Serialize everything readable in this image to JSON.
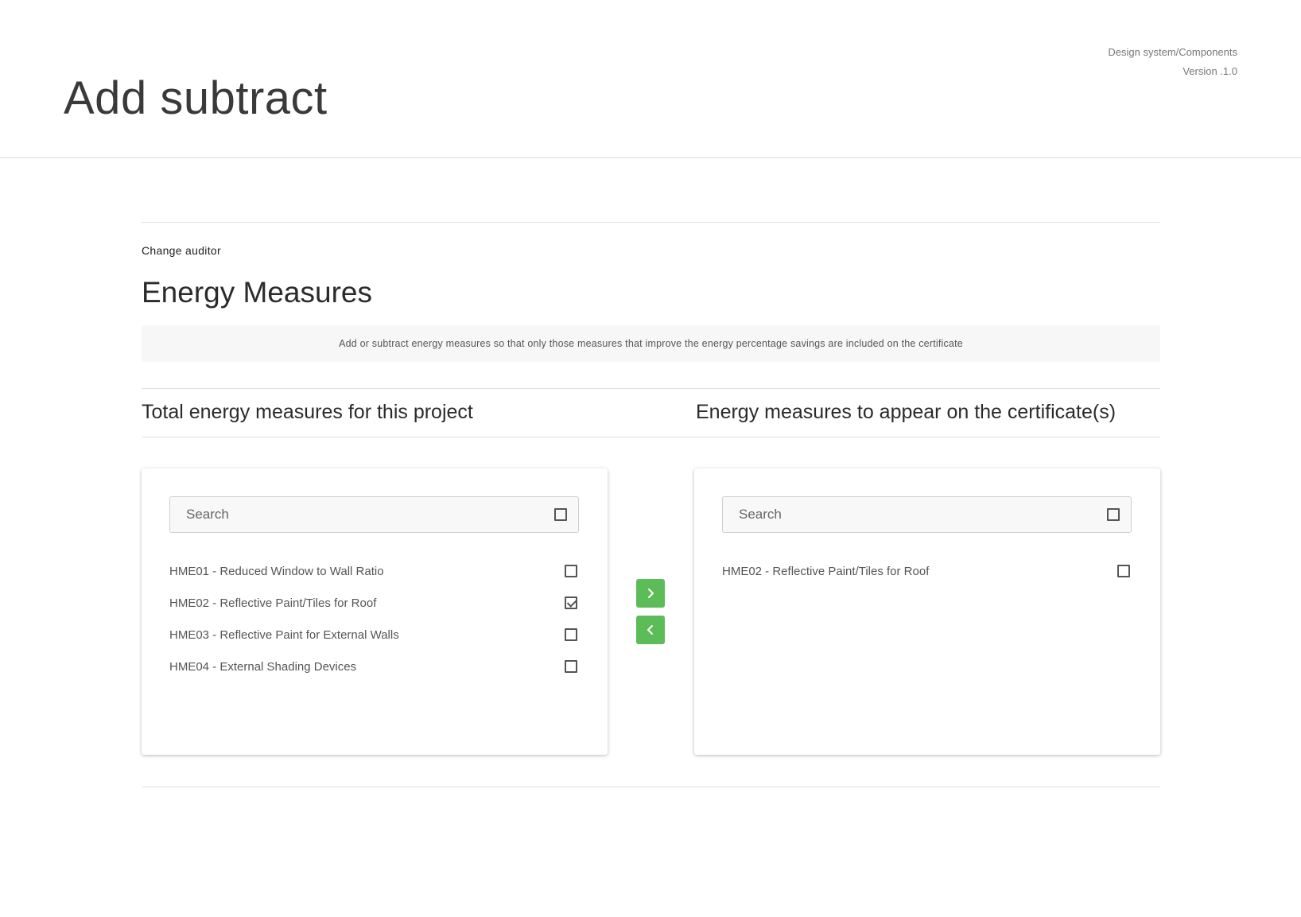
{
  "header": {
    "title": "Add subtract",
    "meta_line1": "Design system/Components",
    "meta_line2": "Version .1.0"
  },
  "content": {
    "breadcrumb_link": "Change auditor",
    "section_title": "Energy Measures",
    "info_text": "Add or subtract energy measures so that only those measures that improve the energy percentage savings are included on the certificate"
  },
  "left_panel": {
    "title": "Total energy measures for this project",
    "search_placeholder": "Search",
    "items": [
      {
        "label": "HME01 - Reduced Window to Wall Ratio",
        "checked": false
      },
      {
        "label": "HME02 - Reflective Paint/Tiles for Roof",
        "checked": true
      },
      {
        "label": "HME03 - Reflective Paint for External Walls",
        "checked": false
      },
      {
        "label": "HME04 - External Shading Devices",
        "checked": false
      }
    ]
  },
  "right_panel": {
    "title": "Energy measures to appear on the certificate(s)",
    "search_placeholder": "Search",
    "items": [
      {
        "label": "HME02 - Reflective Paint/Tiles for Roof",
        "checked": false
      }
    ]
  },
  "transfer": {
    "add_icon": "chevron-right-icon",
    "remove_icon": "chevron-left-icon"
  },
  "colors": {
    "accent_green": "#5cbc57",
    "text_dark": "#2b2b2b",
    "banner_bg": "#f7f7f7"
  }
}
